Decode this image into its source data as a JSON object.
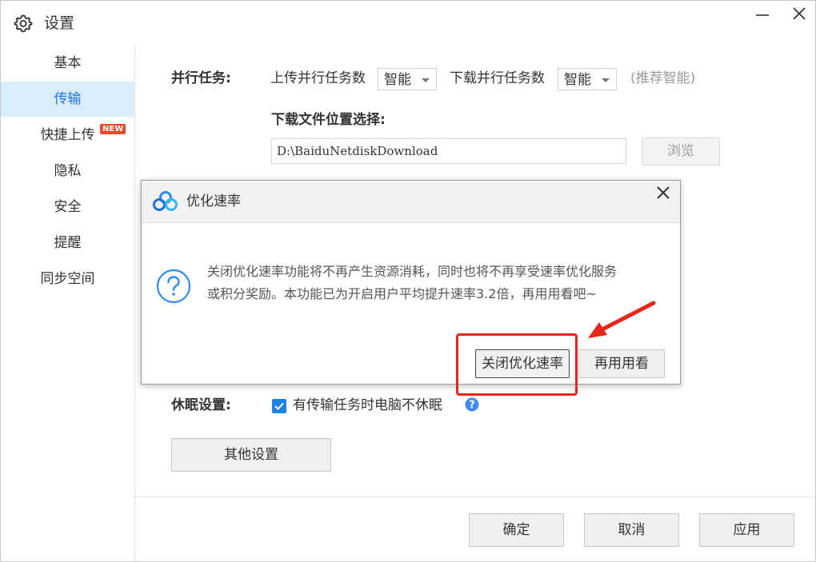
{
  "window": {
    "title": "设置",
    "icon": "gear-icon"
  },
  "sidebar": {
    "items": [
      {
        "label": "基本"
      },
      {
        "label": "传输",
        "active": true
      },
      {
        "label": "快捷上传",
        "badge": "NEW"
      },
      {
        "label": "隐私"
      },
      {
        "label": "安全"
      },
      {
        "label": "提醒"
      },
      {
        "label": "同步空间"
      }
    ]
  },
  "transfer": {
    "parallel_label": "并行任务:",
    "upload_label": "上传并行任务数",
    "upload_value": "智能",
    "download_label": "下载并行任务数",
    "download_value": "智能",
    "recommend_hint": "(推荐智能)",
    "location_label": "下载文件位置选择:",
    "location_path": "D:\\BaiduNetdiskDownload",
    "browse_label": "浏览",
    "sleep_label": "休眠设置:",
    "sleep_checkbox_label": "有传输任务时电脑不休眠",
    "sleep_checked": true,
    "other_settings_label": "其他设置"
  },
  "footer": {
    "ok_label": "确定",
    "cancel_label": "取消",
    "apply_label": "应用"
  },
  "dialog": {
    "title": "优化速率",
    "message_line1": "关闭优化速率功能将不再产生资源消耗，同时也将不再享受速率优化服务",
    "message_line2": "或积分奖励。本功能已为开启用户平均提升速率3.2倍，再用用看吧~",
    "close_speed_label": "关闭优化速率",
    "keep_using_label": "再用用看"
  },
  "colors": {
    "accent": "#1a73e8",
    "active_bg": "#d9edfb",
    "badge": "#f2452c",
    "annotation": "#e8251b"
  }
}
